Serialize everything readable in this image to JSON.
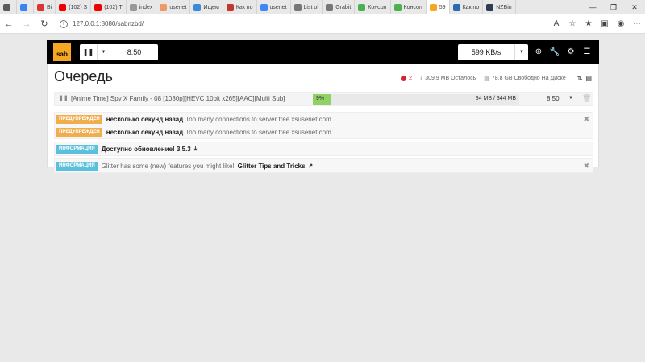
{
  "browser": {
    "tabs": [
      {
        "label": "",
        "color": "#5a5a5a"
      },
      {
        "label": "",
        "color": "#3b82f6"
      },
      {
        "label": "Bi",
        "color": "#d33"
      },
      {
        "label": "(102) S",
        "color": "#e00"
      },
      {
        "label": "(102) T",
        "color": "#e00"
      },
      {
        "label": "index",
        "color": "#999"
      },
      {
        "label": "usenet",
        "color": "#e96"
      },
      {
        "label": "Ищем",
        "color": "#3b8ad8"
      },
      {
        "label": "Как по",
        "color": "#c0392b"
      },
      {
        "label": "usenet",
        "color": "#4285f4"
      },
      {
        "label": "List of",
        "color": "#777"
      },
      {
        "label": "Grabit",
        "color": "#777"
      },
      {
        "label": "Консол",
        "color": "#4caf50"
      },
      {
        "label": "Консол",
        "color": "#4caf50"
      },
      {
        "label": "59",
        "color": "#f5a623",
        "active": true
      },
      {
        "label": "Как по",
        "color": "#2b6cb0"
      },
      {
        "label": "NZBin",
        "color": "#2c3e50"
      }
    ],
    "url": "127.0.0.1:8080/sabnzbd/"
  },
  "nav": {
    "logo": "sab",
    "pause_time": "8:50",
    "speed": "599 KB/s"
  },
  "queue": {
    "title": "Очередь",
    "warnings_count": "2",
    "remaining": "309.9 MB Осталось",
    "free_space": "78.8 GB Свободно На Диске"
  },
  "job": {
    "name": "[Anime Time] Spy X Family - 08 [1080p][HEVC 10bit x265][AAC][Multi Sub]",
    "progress_label": "9%",
    "progress": 0.09,
    "size": "34 MB / 344 MB",
    "eta": "8:50"
  },
  "notices": {
    "warnings": [
      {
        "badge": "ПРЕДУПРЕЖДЕН",
        "time": "несколько секунд назад",
        "message": "Too many connections to server free.xsusenet.com"
      },
      {
        "badge": "ПРЕДУПРЕЖДЕН",
        "time": "несколько секунд назад",
        "message": "Too many connections to server free.xsusenet.com"
      }
    ],
    "update": {
      "badge": "ИНФОРМАЦИЯ",
      "text": "Доступно обновление! 3.5.3"
    },
    "glitter": {
      "badge": "ИНФОРМАЦИЯ",
      "text": "Glitter has some (new) features you might like!",
      "link": "Glitter Tips and Tricks"
    }
  }
}
